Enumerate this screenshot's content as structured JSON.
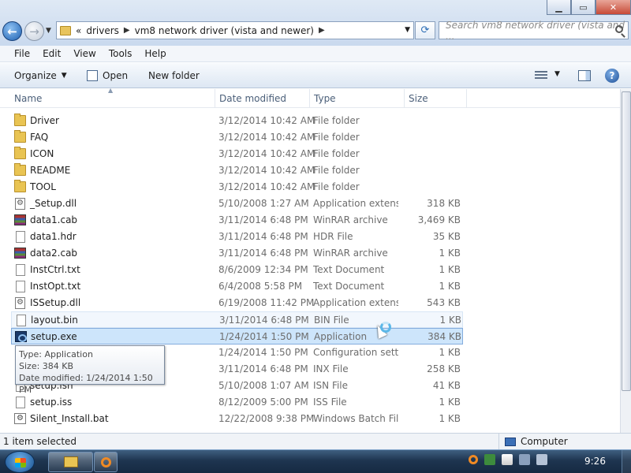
{
  "window": {
    "minimize": "0",
    "maximize": "1",
    "close": "r"
  },
  "address": {
    "overflow": "«",
    "crumbs": [
      "drivers",
      "vm8 network driver (vista and newer)"
    ]
  },
  "search": {
    "placeholder": "Search vm8 network driver (vista and ..."
  },
  "menu": [
    "File",
    "Edit",
    "View",
    "Tools",
    "Help"
  ],
  "toolbar": {
    "organize": "Organize",
    "open": "Open",
    "new_folder": "New folder"
  },
  "columns": {
    "name": "Name",
    "date": "Date modified",
    "type": "Type",
    "size": "Size"
  },
  "files": [
    {
      "name": "Driver",
      "date": "3/12/2014 10:42 AM",
      "type": "File folder",
      "size": "",
      "icon": "folder-icon"
    },
    {
      "name": "FAQ",
      "date": "3/12/2014 10:42 AM",
      "type": "File folder",
      "size": "",
      "icon": "folder-icon"
    },
    {
      "name": "ICON",
      "date": "3/12/2014 10:42 AM",
      "type": "File folder",
      "size": "",
      "icon": "folder-icon"
    },
    {
      "name": "README",
      "date": "3/12/2014 10:42 AM",
      "type": "File folder",
      "size": "",
      "icon": "folder-icon"
    },
    {
      "name": "TOOL",
      "date": "3/12/2014 10:42 AM",
      "type": "File folder",
      "size": "",
      "icon": "folder-icon"
    },
    {
      "name": "_Setup.dll",
      "date": "5/10/2008 1:27 AM",
      "type": "Application extens...",
      "size": "318 KB",
      "icon": "dll-icon"
    },
    {
      "name": "data1.cab",
      "date": "3/11/2014 6:48 PM",
      "type": "WinRAR archive",
      "size": "3,469 KB",
      "icon": "rar-icon"
    },
    {
      "name": "data1.hdr",
      "date": "3/11/2014 6:48 PM",
      "type": "HDR File",
      "size": "35 KB",
      "icon": "file-icon"
    },
    {
      "name": "data2.cab",
      "date": "3/11/2014 6:48 PM",
      "type": "WinRAR archive",
      "size": "1 KB",
      "icon": "rar-icon"
    },
    {
      "name": "InstCtrl.txt",
      "date": "8/6/2009 12:34 PM",
      "type": "Text Document",
      "size": "1 KB",
      "icon": "file-icon"
    },
    {
      "name": "InstOpt.txt",
      "date": "6/4/2008 5:58 PM",
      "type": "Text Document",
      "size": "1 KB",
      "icon": "file-icon"
    },
    {
      "name": "ISSetup.dll",
      "date": "6/19/2008 11:42 PM",
      "type": "Application extens...",
      "size": "543 KB",
      "icon": "dll-icon"
    },
    {
      "name": "layout.bin",
      "date": "3/11/2014 6:48 PM",
      "type": "BIN File",
      "size": "1 KB",
      "icon": "file-icon"
    },
    {
      "name": "setup.exe",
      "date": "1/24/2014 1:50 PM",
      "type": "Application",
      "size": "384 KB",
      "icon": "exe-icon"
    },
    {
      "name": "",
      "date": "1/24/2014 1:50 PM",
      "type": "Configuration sett...",
      "size": "1 KB",
      "icon": "file-icon"
    },
    {
      "name": "",
      "date": "3/11/2014 6:48 PM",
      "type": "INX File",
      "size": "258 KB",
      "icon": "file-icon"
    },
    {
      "name": "setup.isn",
      "date": "5/10/2008 1:07 AM",
      "type": "ISN File",
      "size": "41 KB",
      "icon": "file-icon"
    },
    {
      "name": "setup.iss",
      "date": "8/12/2009 5:00 PM",
      "type": "ISS File",
      "size": "1 KB",
      "icon": "file-icon"
    },
    {
      "name": "Silent_Install.bat",
      "date": "12/22/2008 9:38 PM",
      "type": "Windows Batch File",
      "size": "1 KB",
      "icon": "bat-icon"
    }
  ],
  "tooltip": {
    "type": "Type: Application",
    "size": "Size: 384 KB",
    "modified": "Date modified: 1/24/2014 1:50 PM"
  },
  "status": {
    "selection": "1 item selected",
    "location": "Computer"
  },
  "taskbar": {
    "clock": "9:26"
  }
}
